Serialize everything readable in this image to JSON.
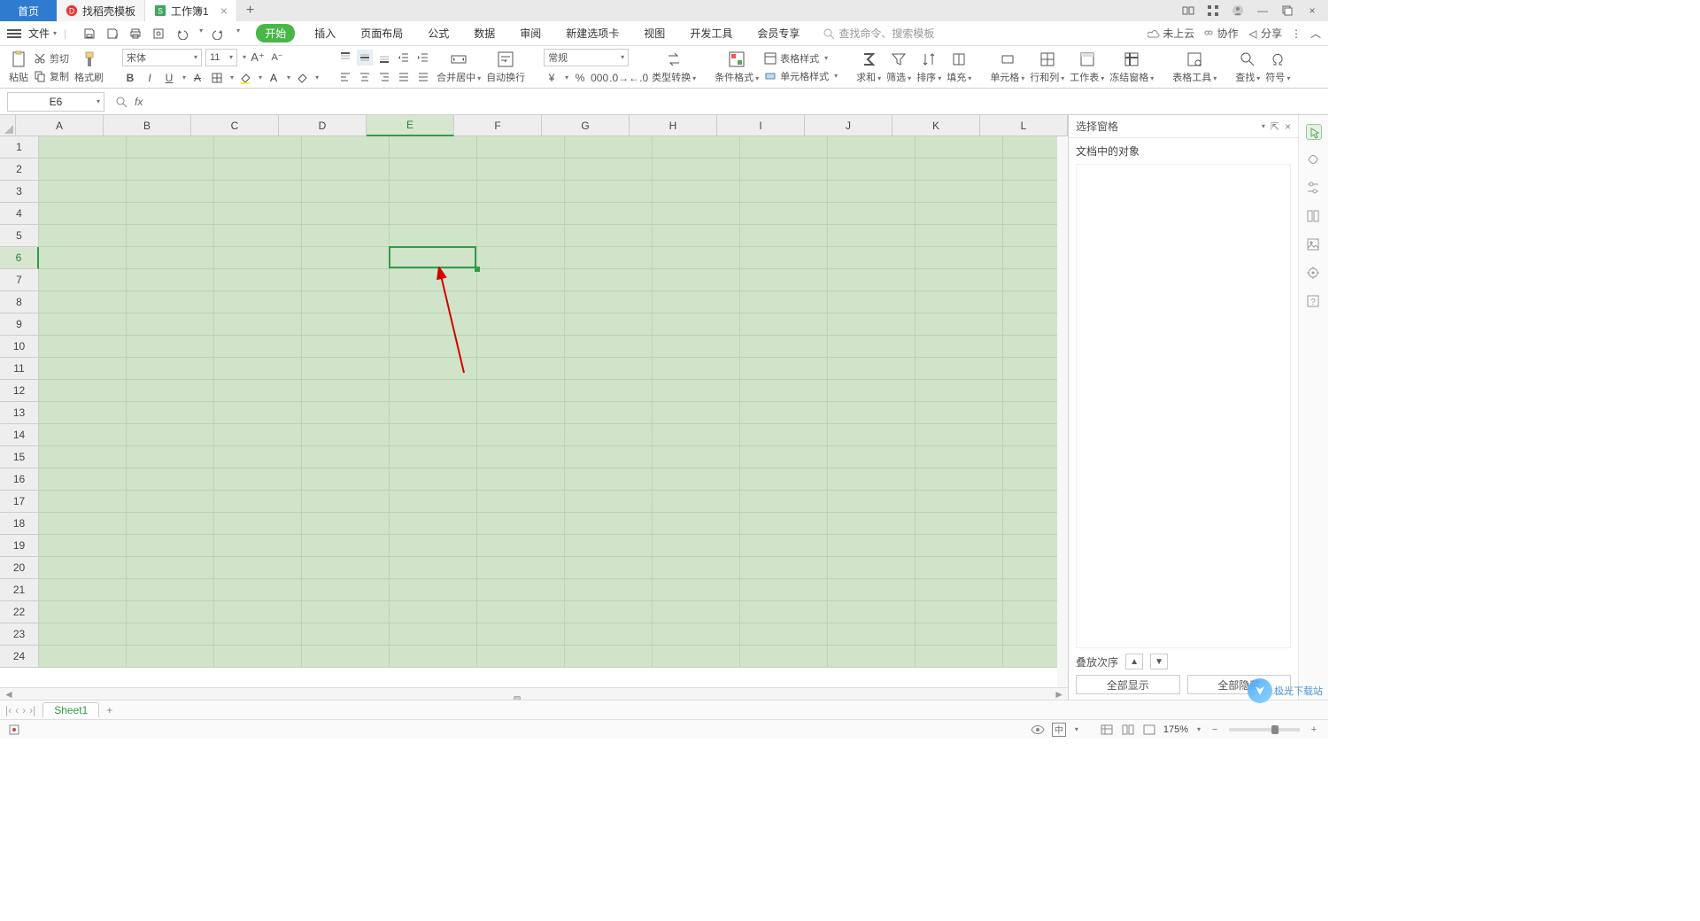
{
  "titlebar": {
    "home": "首页",
    "tab_template": "找稻壳模板",
    "tab_workbook": "工作簿1"
  },
  "menubar": {
    "file": "文件",
    "search_placeholder": "查找命令、搜索模板",
    "tabs": {
      "start": "开始",
      "insert": "插入",
      "page_layout": "页面布局",
      "formulas": "公式",
      "data": "数据",
      "review": "审阅",
      "new_tab": "新建选项卡",
      "view": "视图",
      "dev": "开发工具",
      "member": "会员专享"
    },
    "cloud": "未上云",
    "collab": "协作",
    "share": "分享"
  },
  "ribbon": {
    "paste": "粘贴",
    "cut": "剪切",
    "copy": "复制",
    "format_painter": "格式刷",
    "font_name": "宋体",
    "font_size": "11",
    "merge_center": "合并居中",
    "wrap_text": "自动换行",
    "number_format": "常规",
    "type_convert": "类型转换",
    "cond_fmt": "条件格式",
    "table_style": "表格样式",
    "cell_style": "单元格样式",
    "sum": "求和",
    "filter": "筛选",
    "sort": "排序",
    "fill": "填充",
    "cell": "单元格",
    "row_col": "行和列",
    "worksheet": "工作表",
    "freeze": "冻结窗格",
    "table_tools": "表格工具",
    "find": "查找",
    "symbol": "符号"
  },
  "formula_bar": {
    "cell_ref": "E6"
  },
  "grid": {
    "columns": [
      "A",
      "B",
      "C",
      "D",
      "E",
      "F",
      "G",
      "H",
      "I",
      "J",
      "K",
      "L"
    ],
    "selected_col": "E",
    "rows": [
      1,
      2,
      3,
      4,
      5,
      6,
      7,
      8,
      9,
      10,
      11,
      12,
      13,
      14,
      15,
      16,
      17,
      18,
      19,
      20,
      21,
      22,
      23,
      24
    ],
    "selected_row": 6
  },
  "sheetbar": {
    "sheet1": "Sheet1"
  },
  "side_panel": {
    "title": "选择窗格",
    "objects_label": "文档中的对象",
    "stack_label": "叠放次序",
    "show_all": "全部显示",
    "hide_all": "全部隐藏"
  },
  "statusbar": {
    "zoom": "175%",
    "ime": "中"
  },
  "watermark": {
    "text": "极光下载站"
  }
}
